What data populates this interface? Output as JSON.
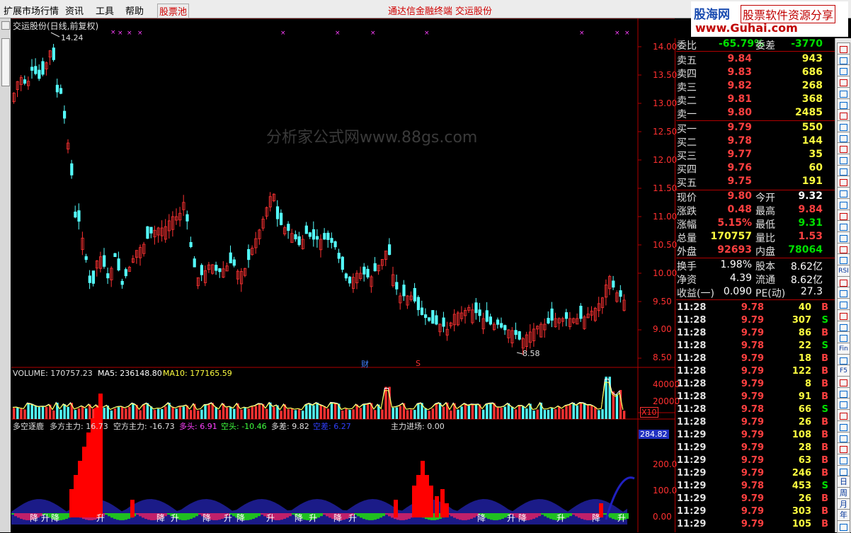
{
  "menu": {
    "items": [
      "扩展市场行情",
      "资讯",
      "工具",
      "帮助"
    ],
    "stock_pool": "股票池",
    "center_title": "通达信金融终端",
    "center_stock": "交运股份"
  },
  "logo": {
    "site_name": "股海网",
    "slogan": "股票软件资源分享",
    "url": "www.Guhai.com"
  },
  "chart_header": "交运股份(日线,前复权)",
  "watermark": "分析家公式网www.88gs.com",
  "price_chart": {
    "high_label": "14.24",
    "low_label": "8.58",
    "marker_cai": "财",
    "marker_s": "S",
    "axis_ticks": [
      "14.00",
      "13.50",
      "13.00",
      "12.50",
      "12.00",
      "11.50",
      "11.00",
      "10.50",
      "10.00",
      "9.50",
      "9.00",
      "8.50"
    ]
  },
  "volume_panel": {
    "label_volume": "VOLUME: 170757.23",
    "label_ma5": "MA5: 236148.80",
    "label_ma10": "MA10: 177165.59",
    "axis_ticks": [
      "40000",
      "20000"
    ],
    "unit": "X10"
  },
  "indicator_panel": {
    "name": "多空逐鹿",
    "bull_main": "多方主力: 16.73",
    "bear_main": "空方主力: -16.73",
    "long": "多头: 6.91",
    "short": "空头: -10.46",
    "diff": "多差: 9.82",
    "blue_label": "空差: 6.27",
    "inflow": "主力进场: 0.00",
    "current_value": "284.82",
    "axis_ticks": [
      "200.0",
      "100.0",
      "0.00"
    ],
    "bottom_labels": [
      "降",
      "升",
      "降",
      "升",
      "降",
      "升",
      "降",
      "升",
      "降",
      "升",
      "降",
      "升",
      "降",
      "升",
      "降",
      "升",
      "降",
      "升",
      "降",
      "升"
    ]
  },
  "quote": {
    "weibi": {
      "label": "委比",
      "value": "-65.79%",
      "label2": "委差",
      "value2": "-3770"
    },
    "asks": [
      {
        "label": "卖五",
        "price": "9.84",
        "vol": "943"
      },
      {
        "label": "卖四",
        "price": "9.83",
        "vol": "686"
      },
      {
        "label": "卖三",
        "price": "9.82",
        "vol": "268"
      },
      {
        "label": "卖二",
        "price": "9.81",
        "vol": "368"
      },
      {
        "label": "卖一",
        "price": "9.80",
        "vol": "2485"
      }
    ],
    "bids": [
      {
        "label": "买一",
        "price": "9.79",
        "vol": "550"
      },
      {
        "label": "买二",
        "price": "9.78",
        "vol": "144"
      },
      {
        "label": "买三",
        "price": "9.77",
        "vol": "35"
      },
      {
        "label": "买四",
        "price": "9.76",
        "vol": "60"
      },
      {
        "label": "买五",
        "price": "9.75",
        "vol": "191"
      }
    ],
    "stats": [
      {
        "l1": "现价",
        "v1": "9.80",
        "l2": "今开",
        "v2": "9.32",
        "c1": "#ff4040",
        "c2": "#ffffff"
      },
      {
        "l1": "涨跌",
        "v1": "0.48",
        "l2": "最高",
        "v2": "9.84",
        "c1": "#ff4040",
        "c2": "#ff4040"
      },
      {
        "l1": "涨幅",
        "v1": "5.15%",
        "l2": "最低",
        "v2": "9.31",
        "c1": "#ff4040",
        "c2": "#00e000"
      },
      {
        "l1": "总量",
        "v1": "170757",
        "l2": "量比",
        "v2": "1.53",
        "c1": "#ffff40",
        "c2": "#ff4040"
      },
      {
        "l1": "外盘",
        "v1": "92693",
        "l2": "内盘",
        "v2": "78064",
        "c1": "#ff4040",
        "c2": "#00e000"
      }
    ],
    "fin": [
      {
        "l1": "换手",
        "v1": "1.98%",
        "l2": "股本",
        "v2": "8.62亿"
      },
      {
        "l1": "净资",
        "v1": "4.39",
        "l2": "流通",
        "v2": "8.62亿"
      },
      {
        "l1": "收益(一)",
        "v1": "0.090",
        "l2": "PE(动)",
        "v2": "27.3"
      }
    ],
    "ticks": [
      {
        "t": "11:28",
        "p": "9.78",
        "v": "40",
        "d": "B"
      },
      {
        "t": "11:28",
        "p": "9.79",
        "v": "307",
        "d": "S"
      },
      {
        "t": "11:28",
        "p": "9.79",
        "v": "86",
        "d": "B"
      },
      {
        "t": "11:28",
        "p": "9.78",
        "v": "22",
        "d": "S"
      },
      {
        "t": "11:28",
        "p": "9.79",
        "v": "18",
        "d": "B"
      },
      {
        "t": "11:28",
        "p": "9.79",
        "v": "122",
        "d": "B"
      },
      {
        "t": "11:28",
        "p": "9.79",
        "v": "8",
        "d": "B"
      },
      {
        "t": "11:28",
        "p": "9.79",
        "v": "91",
        "d": "B"
      },
      {
        "t": "11:28",
        "p": "9.78",
        "v": "66",
        "d": "S"
      },
      {
        "t": "11:28",
        "p": "9.79",
        "v": "26",
        "d": "B"
      },
      {
        "t": "11:29",
        "p": "9.79",
        "v": "108",
        "d": "B"
      },
      {
        "t": "11:29",
        "p": "9.79",
        "v": "28",
        "d": "B"
      },
      {
        "t": "11:29",
        "p": "9.79",
        "v": "63",
        "d": "B"
      },
      {
        "t": "11:29",
        "p": "9.79",
        "v": "246",
        "d": "B"
      },
      {
        "t": "11:29",
        "p": "9.78",
        "v": "453",
        "d": "S"
      },
      {
        "t": "11:29",
        "p": "9.79",
        "v": "26",
        "d": "B"
      },
      {
        "t": "11:29",
        "p": "9.79",
        "v": "303",
        "d": "B"
      },
      {
        "t": "11:29",
        "p": "9.79",
        "v": "105",
        "d": "B"
      }
    ]
  },
  "right_toolbar": [
    "RSI",
    "Fin",
    "F5",
    "日",
    "周",
    "月",
    "年"
  ],
  "colors": {
    "up": "#ff3232",
    "down": "#54ffff",
    "bg": "#000000",
    "grid": "#b00000"
  }
}
